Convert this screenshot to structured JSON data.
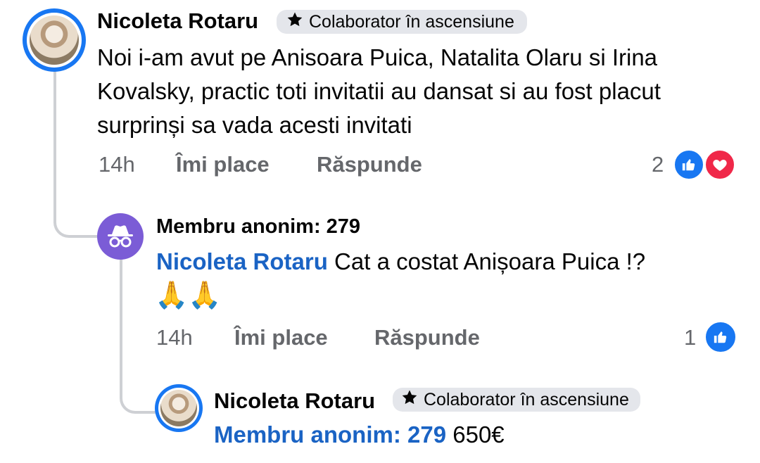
{
  "comments": [
    {
      "author": "Nicoleta Rotaru",
      "badge": "Colaborator în ascensiune",
      "text": "Noi i-am avut pe Anisoara Puica, Natalita Olaru si Irina Kovalsky, practic toti invitatii au dansat si au fost placut surprinși sa vada acesti invitati",
      "time": "14h",
      "like_label": "Îmi place",
      "reply_label": "Răspunde",
      "reaction_count": "2",
      "reactions": [
        "like-icon",
        "love-icon"
      ]
    },
    {
      "author": "Membru anonim: 279",
      "mention": "Nicoleta Rotaru",
      "text": " Cat a costat Anișoara Puica !?",
      "emoji": "🙏🙏",
      "time": "14h",
      "like_label": "Îmi place",
      "reply_label": "Răspunde",
      "reaction_count": "1",
      "reactions": [
        "like-icon"
      ]
    },
    {
      "author": "Nicoleta Rotaru",
      "badge": "Colaborator în ascensiune",
      "mention": "Membru anonim: 279",
      "text": " 650€"
    }
  ],
  "colors": {
    "accent": "#1877f2",
    "mention": "#1a63c4",
    "love": "#f02849",
    "anon_avatar": "#7b5cd6",
    "meta": "#65676b"
  }
}
